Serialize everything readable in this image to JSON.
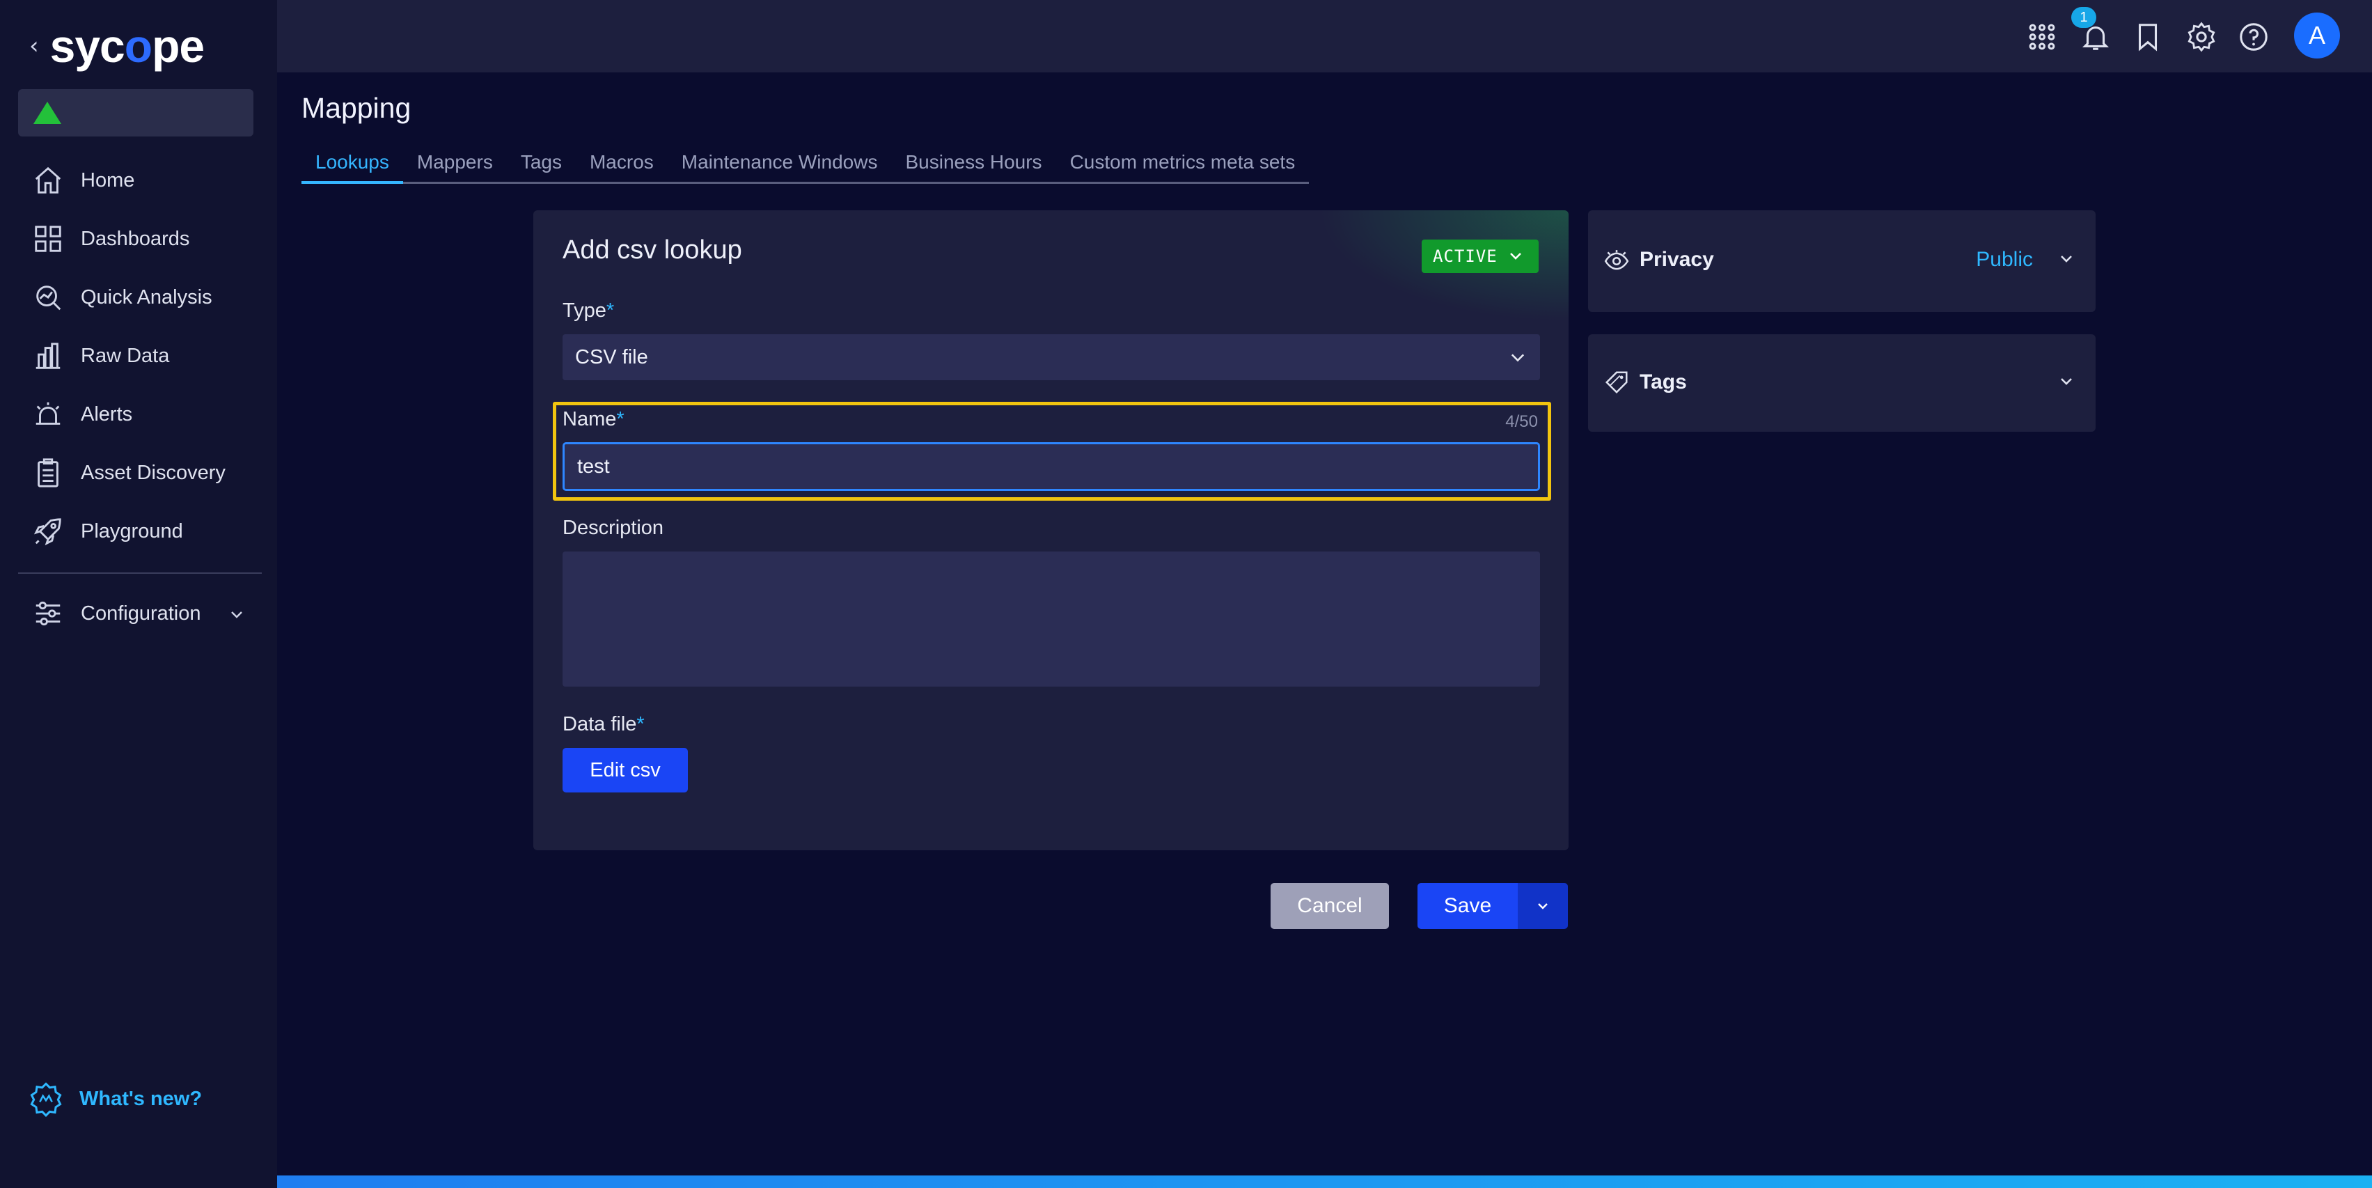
{
  "app": {
    "logo_text_a": "syc",
    "logo_text_b": "o",
    "logo_text_c": "pe"
  },
  "sidebar": {
    "items": [
      {
        "label": "Home",
        "icon": "home-icon"
      },
      {
        "label": "Dashboards",
        "icon": "dashboards-icon"
      },
      {
        "label": "Quick Analysis",
        "icon": "quick-analysis-icon"
      },
      {
        "label": "Raw Data",
        "icon": "raw-data-icon"
      },
      {
        "label": "Alerts",
        "icon": "alarm-icon"
      },
      {
        "label": "Asset Discovery",
        "icon": "clipboard-list-icon"
      },
      {
        "label": "Playground",
        "icon": "rocket-icon"
      }
    ],
    "configuration": {
      "label": "Configuration",
      "icon": "sliders-icon"
    },
    "whats_new": {
      "label": "What's new?",
      "icon": "new-badge-icon"
    },
    "status_color": "#23c13a"
  },
  "topbar": {
    "notification_count": "1",
    "avatar_initial": "A",
    "icons": [
      "apps-grid-icon",
      "bell-icon",
      "bookmark-icon",
      "gear-icon",
      "help-icon"
    ]
  },
  "page": {
    "title": "Mapping",
    "tabs": [
      "Lookups",
      "Mappers",
      "Tags",
      "Macros",
      "Maintenance Windows",
      "Business Hours",
      "Custom metrics meta sets"
    ],
    "active_tab": "Lookups"
  },
  "form": {
    "title": "Add csv lookup",
    "status": "ACTIVE",
    "type_label": "Type",
    "type_value": "CSV file",
    "name_label": "Name",
    "name_value": "test",
    "name_counter": "4/50",
    "description_label": "Description",
    "description_value": "",
    "data_file_label": "Data file",
    "edit_csv_label": "Edit csv",
    "required_mark": "*"
  },
  "actions": {
    "cancel_label": "Cancel",
    "save_label": "Save"
  },
  "side_panel": {
    "privacy": {
      "title": "Privacy",
      "value": "Public"
    },
    "tags": {
      "title": "Tags"
    }
  },
  "colors": {
    "accent": "#1a45f5",
    "link": "#2fb8ff",
    "active_badge": "#119a2c",
    "highlight": "#f1c40f"
  }
}
